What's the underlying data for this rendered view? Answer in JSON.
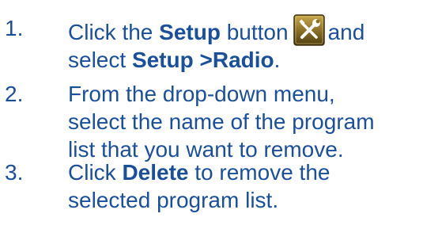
{
  "steps": [
    {
      "number": "1.",
      "line1_pre": "Click the ",
      "line1_bold": "Setup",
      "line1_post": " button",
      "line1_end": "and",
      "line2_pre": "select ",
      "line2_bold": "Setup >Radio",
      "line2_post": "."
    },
    {
      "number": "2.",
      "lines": [
        "From the drop-down menu,",
        "select the name of the program",
        "list that you want to remove."
      ]
    },
    {
      "number": "3.",
      "line1_pre": "Click ",
      "line1_bold": "Delete",
      "line1_post": " to remove the",
      "line2": "selected program list."
    }
  ],
  "icons": {
    "setup_button": "tools-wrench-screwdriver-icon"
  },
  "colors": {
    "text": "#1a4f9c",
    "icon_background": "#6b5a1e",
    "icon_highlight": "#c9a84a",
    "icon_tools": "#ffffff"
  }
}
